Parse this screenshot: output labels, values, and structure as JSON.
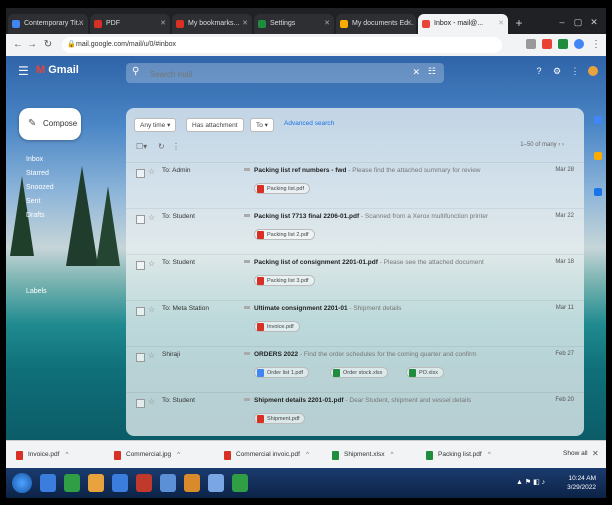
{
  "browser": {
    "tabs": [
      {
        "label": "Contemporary Tit...",
        "active": false,
        "favicon_color": "#4285f4"
      },
      {
        "label": "PDF",
        "active": false,
        "favicon_color": "#d93025"
      },
      {
        "label": "My bookmarks...",
        "active": false,
        "favicon_color": "#d93025"
      },
      {
        "label": "Settings",
        "active": false,
        "favicon_color": "#1e8e3e"
      },
      {
        "label": "My documents Ed...",
        "active": false,
        "favicon_color": "#f9ab00"
      },
      {
        "label": "Inbox - mail@...",
        "active": true,
        "favicon_color": "#ea4335"
      }
    ],
    "new_tab": "+",
    "window_controls": [
      "–",
      "▢",
      "✕"
    ],
    "url": "mail.google.com/mail/u/0/#inbox"
  },
  "gmail": {
    "logo_text": "Gmail",
    "search": {
      "value": "",
      "placeholder": "Search mail"
    },
    "compose_label": "Compose",
    "sidebar": {
      "items": [
        "Inbox",
        "Starred",
        "Snoozed",
        "Sent",
        "Drafts"
      ],
      "labels_heading": "Labels"
    },
    "filters": {
      "chips": [
        "Any time ▾",
        "Has attachment",
        "To ▾"
      ],
      "advanced": "Advanced search"
    },
    "pager": "1–50 of many",
    "rows": [
      {
        "sender": "To: Admin",
        "subject": "Packing list ref numbers - fwd",
        "snippet": " - Please find the attached summary for review",
        "date": "Mar 28",
        "attachments": [
          {
            "name": "Packing list.pdf",
            "type": "pdf"
          }
        ]
      },
      {
        "sender": "To: Student",
        "subject": "Packing list 7713 final 2206-01.pdf",
        "snippet": " - Scanned from a Xerox multifunction printer",
        "date": "Mar 22",
        "attachments": [
          {
            "name": "Packing list 2.pdf",
            "type": "pdf"
          }
        ]
      },
      {
        "sender": "To: Student",
        "subject": "Packing list of consignment 2201-01.pdf",
        "snippet": " - Please see the attached document",
        "date": "Mar 18",
        "attachments": [
          {
            "name": "Packing list 3.pdf",
            "type": "pdf"
          }
        ]
      },
      {
        "sender": "To: Meta Station",
        "subject": "Ultimate consignment 2201-01",
        "snippet": " - Shipment details",
        "date": "Mar 11",
        "attachments": [
          {
            "name": "Invoice.pdf",
            "type": "pdf"
          }
        ]
      },
      {
        "sender": "Shiraji",
        "subject": "ORDERS 2022",
        "snippet": " - Find the order schedules for the coming quarter and confirm",
        "date": "Feb 27",
        "attachments": [
          {
            "name": "Order list 1.pdf",
            "type": "doc"
          },
          {
            "name": "Order stock.xlsx",
            "type": "xls"
          },
          {
            "name": "PO.xlsx",
            "type": "xls"
          }
        ]
      },
      {
        "sender": "To: Student",
        "subject": "Shipment details 2201-01.pdf",
        "snippet": " - Dear Student, shipment and vessel details",
        "date": "Feb 20",
        "attachments": [
          {
            "name": "Shipment.pdf",
            "type": "pdf"
          }
        ]
      }
    ]
  },
  "downloads": [
    {
      "name": "Invoice.pdf",
      "type": "pdf"
    },
    {
      "name": "Commercial.jpg",
      "type": "pdf"
    },
    {
      "name": "Commercial invoic.pdf",
      "type": "pdf"
    },
    {
      "name": "Shipment.xlsx",
      "type": "xls"
    },
    {
      "name": "Packing list.pdf",
      "type": "xls"
    }
  ],
  "downloads_show_all": "Show all",
  "taskbar": {
    "app_colors": [
      "#3b7ddd",
      "#2f9e44",
      "#e8a33d",
      "#3b7ddd",
      "#c0392b",
      "#5b8fd6",
      "#d98a2b",
      "#7aa6e6",
      "#2f9e44"
    ],
    "time": "10:24 AM",
    "date": "3/29/2022"
  },
  "colors": {
    "accent": "#1a73e8",
    "pdf": "#d93025",
    "sheet": "#1e8e3e",
    "doc": "#4285f4"
  }
}
